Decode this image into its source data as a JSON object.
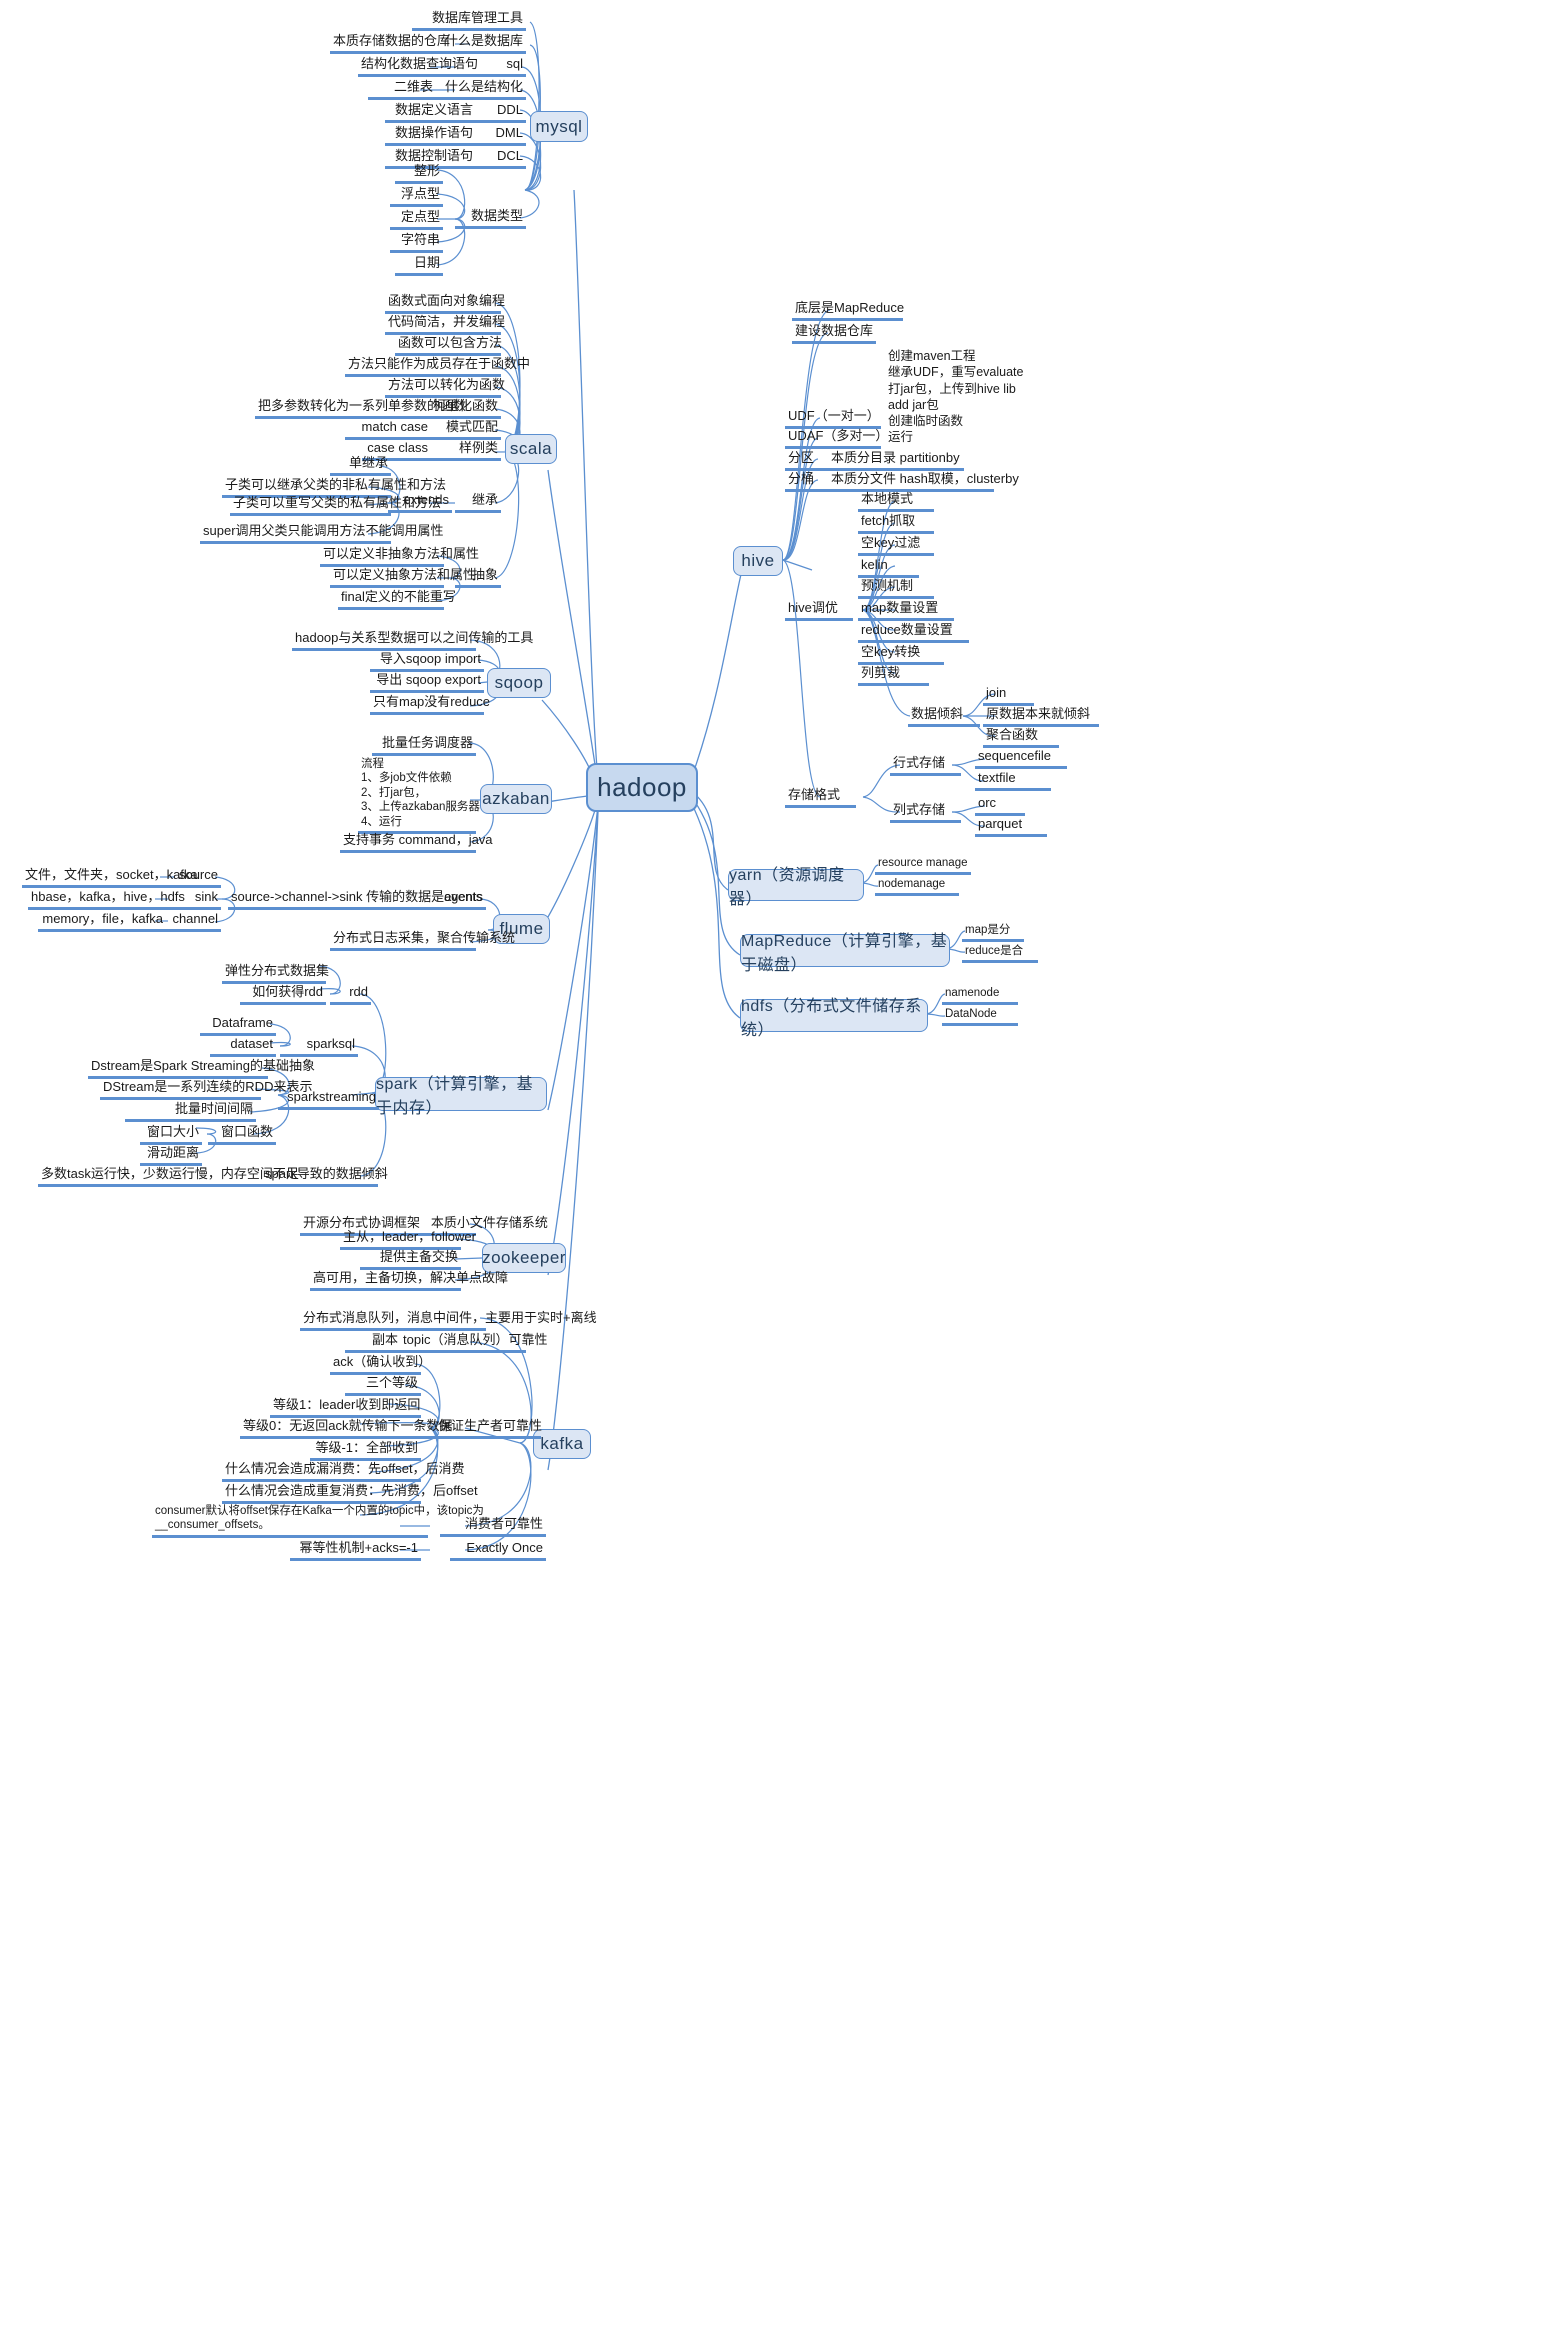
{
  "root": {
    "label": "hadoop"
  },
  "branches": {
    "mysql": {
      "label": "mysql",
      "children": [
        {
          "label": "什么是数据库",
          "subs": [
            "数据库管理工具",
            "本质存储数据的仓库"
          ]
        },
        {
          "label": "sql",
          "subs": [
            "结构化数据查询语句"
          ]
        },
        {
          "label": "什么是结构化",
          "subs": [
            "二维表"
          ]
        },
        {
          "label": "DDL",
          "subs": [
            "数据定义语言"
          ]
        },
        {
          "label": "DML",
          "subs": [
            "数据操作语句"
          ]
        },
        {
          "label": "DCL",
          "subs": [
            "数据控制语句"
          ]
        },
        {
          "label": "数据类型",
          "subs": [
            "整形",
            "浮点型",
            "定点型",
            "字符串",
            "日期"
          ]
        }
      ]
    },
    "scala": {
      "label": "scala",
      "children": [
        {
          "label": "函数式面向对象编程"
        },
        {
          "label": "代码简洁，并发编程"
        },
        {
          "label": "函数可以包含方法"
        },
        {
          "label": "方法只能作为成员存在于函数中"
        },
        {
          "label": "方法可以转化为函数"
        },
        {
          "label": "柯里化函数",
          "subs": [
            "把多参数转化为一系列单参数的函数"
          ]
        },
        {
          "label": "模式匹配",
          "subs": [
            "match case"
          ]
        },
        {
          "label": "样例类",
          "subs": [
            "case class"
          ]
        },
        {
          "label": "继承",
          "mid": "extends",
          "subs": [
            "单继承",
            "子类可以继承父类的非私有属性和方法",
            "子类可以重写父类的私有属性和方法",
            "super调用父类只能调用方法不能调用属性"
          ]
        },
        {
          "label": "抽象",
          "subs": [
            "可以定义非抽象方法和属性",
            "可以定义抽象方法和属性",
            "final定义的不能重写"
          ]
        }
      ]
    },
    "sqoop": {
      "label": "sqoop",
      "children": [
        {
          "label": "hadoop与关系型数据可以之间传输的工具"
        },
        {
          "label": "导入sqoop import"
        },
        {
          "label": "导出 sqoop export"
        },
        {
          "label": "只有map没有reduce"
        }
      ]
    },
    "azkaban": {
      "label": "azkaban",
      "children": [
        {
          "label": "批量任务调度器"
        },
        {
          "label": "流程\n1、多job文件依赖\n2、打jar包，\n3、上传azkaban服务器\n4、运行"
        },
        {
          "label": "支持事务 command，java"
        }
      ]
    },
    "flume": {
      "label": "flume",
      "children": [
        {
          "label": "agents",
          "mid": "source->channel->sink 传输的数据是events",
          "subs": [
            {
              "label": "source",
              "subs": [
                "文件，文件夹，socket，kafka"
              ]
            },
            {
              "label": "sink",
              "subs": [
                "hbase，kafka，hive，hdfs"
              ]
            },
            {
              "label": "channel",
              "subs": [
                "memory，file，kafka"
              ]
            }
          ]
        },
        {
          "label": "分布式日志采集，聚合传输系统"
        }
      ]
    },
    "spark": {
      "label": "spark（计算引擎，基于内存）",
      "children": [
        {
          "label": "rdd",
          "subs": [
            "弹性分布式数据集",
            "如何获得rdd"
          ]
        },
        {
          "label": "sparksql",
          "subs": [
            "Dataframe",
            "dataset"
          ]
        },
        {
          "label": "sparkstreaming",
          "subs": [
            "Dstream是Spark Streaming的基础抽象",
            "DStream是一系列连续的RDD来表示",
            "批量时间间隔"
          ],
          "window": {
            "label": "窗口函数",
            "subs": [
              "窗口大小",
              "滑动距离"
            ]
          }
        },
        {
          "label": "spark导致的数据倾斜",
          "subs": [
            "多数task运行快，少数运行慢，内存空间不足"
          ]
        }
      ]
    },
    "zookeeper": {
      "label": "zookeeper",
      "children": [
        {
          "label": "开源分布式协调框架   本质小文件存储系统"
        },
        {
          "label": "主从，leader，follower"
        },
        {
          "label": "提供主备交换"
        },
        {
          "label": "高可用，主备切换，解决单点故障"
        }
      ]
    },
    "kafka": {
      "label": "kafka",
      "children": [
        {
          "label": "分布式消息队列，消息中间件，主要用于实时+离线"
        },
        {
          "label": "topic（消息队列）可靠性",
          "subs": [
            "副本"
          ]
        },
        {
          "label": "保证生产者可靠性",
          "subs": [
            "ack（确认收到）",
            "三个等级",
            "等级1：leader收到即返回",
            "等级0：无返回ack就传输下一条数据",
            "等级-1：全部收到",
            "什么情况会造成漏消费：先offset，后消费",
            "什么情况会造成重复消费：先消费，后offset"
          ]
        },
        {
          "label": "消费者可靠性",
          "subs": [
            "consumer默认将offset保存在Kafka一个内置的topic中，该topic为\n__consumer_offsets。"
          ]
        },
        {
          "label": "Exactly Once",
          "subs": [
            "幂等性机制+acks=-1"
          ]
        }
      ]
    },
    "hive": {
      "label": "hive",
      "children": [
        {
          "label": "底层是MapReduce"
        },
        {
          "label": "建设数据仓库"
        },
        {
          "label": "UDF（一对一）",
          "note": "创建maven工程\n继承UDF，重写evaluate\n打jar包，上传到hive lib\nadd jar包\n创建临时函数\n运行"
        },
        {
          "label": "UDAF（多对一）"
        },
        {
          "label": "分区",
          "note2": "本质分目录 partitionby"
        },
        {
          "label": "分桶",
          "note2": "本质分文件 hash取模，clusterby"
        },
        {
          "label": "hive调优",
          "subs": [
            "本地模式",
            "fetch抓取",
            "空key过滤",
            "kelin",
            "预测机制",
            "map数量设置",
            "reduce数量设置",
            "空key转换",
            "列剪裁"
          ],
          "skew": {
            "label": "数据倾斜",
            "subs": [
              "join",
              "原数据本来就倾斜",
              "聚合函数"
            ]
          }
        },
        {
          "label": "存储格式",
          "groups": [
            {
              "label": "行式存储",
              "subs": [
                "sequencefile",
                "textfile"
              ]
            },
            {
              "label": "列式存储",
              "subs": [
                "orc",
                "parquet"
              ]
            }
          ]
        }
      ]
    },
    "yarn": {
      "label": "yarn（资源调度器）",
      "children": [
        {
          "label": "resource manage"
        },
        {
          "label": "nodemanage"
        }
      ]
    },
    "mapreduce": {
      "label": "MapReduce（计算引擎，基于磁盘）",
      "children": [
        {
          "label": "map是分"
        },
        {
          "label": "reduce是合"
        }
      ]
    },
    "hdfs": {
      "label": "hdfs（分布式文件储存系统）",
      "children": [
        {
          "label": "namenode"
        },
        {
          "label": "DataNode"
        }
      ]
    }
  },
  "colors": {
    "line": "#5b8fd0",
    "underline": "#5b8fd0",
    "box_fill": "#dce6f4",
    "root_fill": "#c7d9ef",
    "text": "#1a1a1a"
  }
}
